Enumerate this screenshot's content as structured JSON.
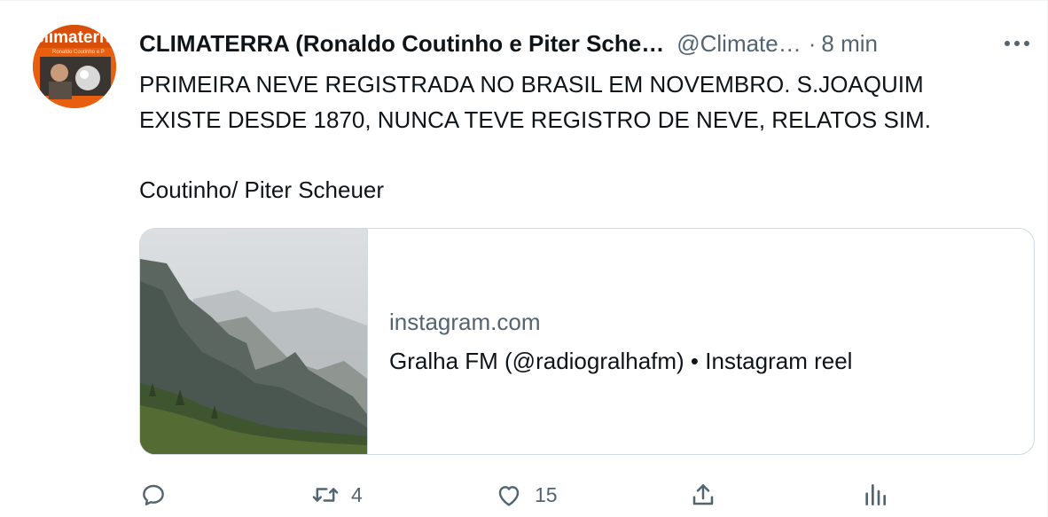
{
  "author": {
    "display_name": "CLIMATERRA (Ronaldo Coutinho e Piter Sche…",
    "handle": "@Climate…",
    "separator": "·",
    "time": "8 min",
    "avatar_text": "climaterra",
    "avatar_subtext": "Ronaldo Coutinho e P"
  },
  "tweet": {
    "line1": "PRIMEIRA NEVE REGISTRADA NO BRASIL EM NOVEMBRO. S.JOAQUIM",
    "line2": "EXISTE  DESDE 1870, NUNCA TEVE REGISTRO DE NEVE, RELATOS SIM.",
    "signature": "Coutinho/ Piter Scheuer"
  },
  "card": {
    "domain": "instagram.com",
    "title": "Gralha FM (@radiogralhafm) • Instagram reel"
  },
  "actions": {
    "reply": {
      "icon": "reply-icon",
      "count": ""
    },
    "retweet": {
      "icon": "retweet-icon",
      "count": "4"
    },
    "like": {
      "icon": "heart-icon",
      "count": "15"
    },
    "share": {
      "icon": "share-icon",
      "count": ""
    },
    "analytics": {
      "icon": "analytics-icon",
      "count": ""
    }
  },
  "colors": {
    "text_primary": "#0f1419",
    "text_secondary": "#536471",
    "border": "#cfd9de",
    "avatar_orange": "#e8600f"
  }
}
